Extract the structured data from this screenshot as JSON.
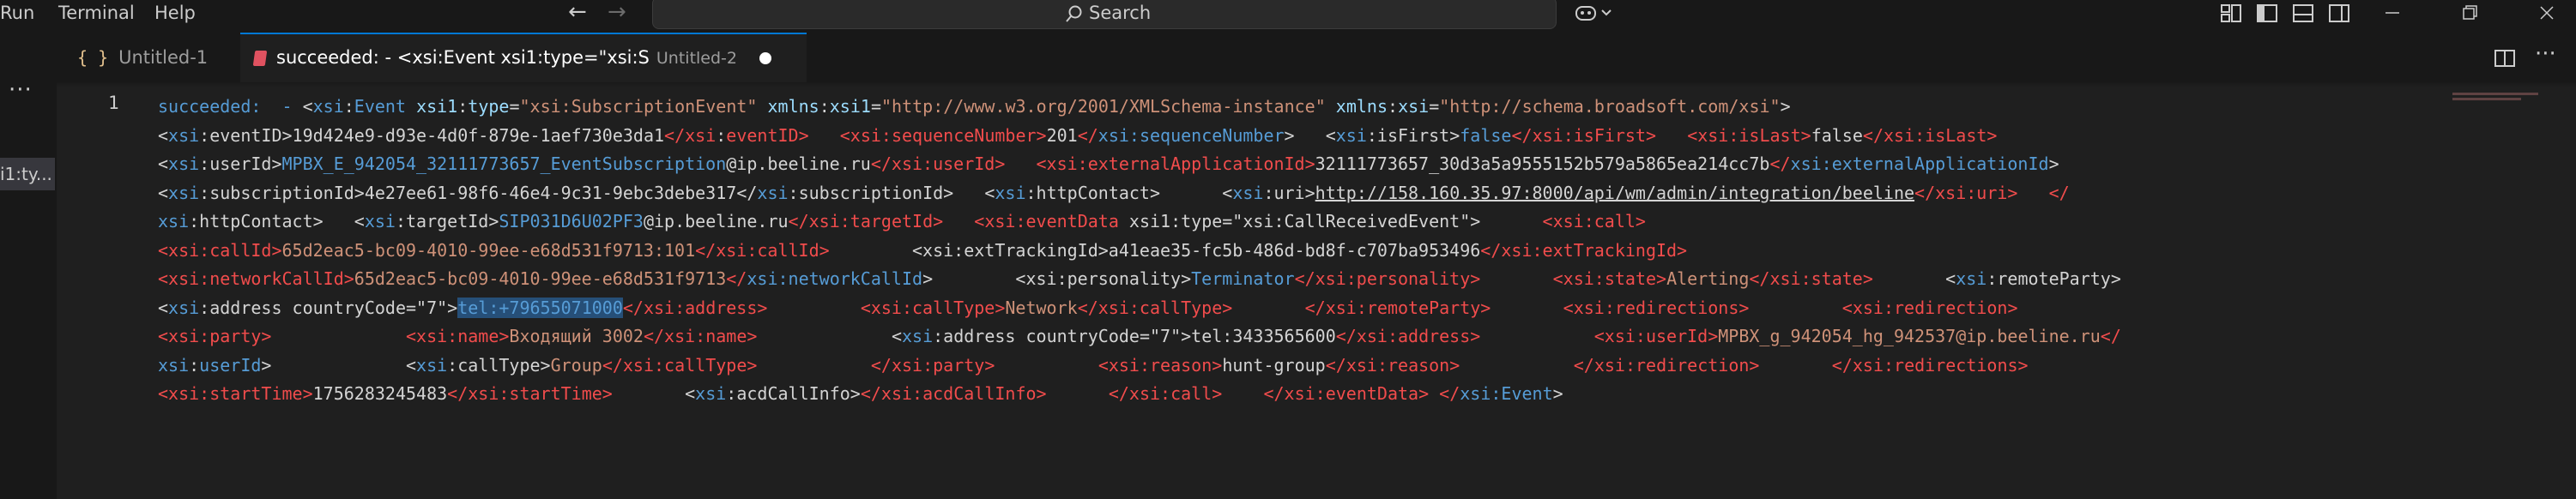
{
  "menu": {
    "items": [
      "Run",
      "Terminal",
      "Help"
    ]
  },
  "search": {
    "label": "Search"
  },
  "activity": {
    "more": "···",
    "peek": "i1:ty..."
  },
  "tabs": [
    {
      "icon": "{ }",
      "label": "Untitled-1"
    },
    {
      "label": "succeeded: - <xsi:Event xsi1:type=\"xsi:S",
      "desc": "Untitled-2"
    }
  ],
  "editor": {
    "line_number": "1",
    "rows": [
      [
        {
          "c": "t-bl",
          "t": "succeeded:  - "
        },
        {
          "c": "t-plain",
          "t": "<"
        },
        {
          "c": "t-ns",
          "t": "xsi"
        },
        {
          "c": "t-plain",
          "t": ":"
        },
        {
          "c": "t-ns",
          "t": "Event"
        },
        {
          "c": "t-plain",
          "t": " "
        },
        {
          "c": "t-attr",
          "t": "xsi1"
        },
        {
          "c": "t-plain",
          "t": ":"
        },
        {
          "c": "t-attr",
          "t": "type"
        },
        {
          "c": "t-plain",
          "t": "="
        },
        {
          "c": "t-str",
          "t": "\"xsi:SubscriptionEvent\""
        },
        {
          "c": "t-plain",
          "t": " "
        },
        {
          "c": "t-attr",
          "t": "xmlns"
        },
        {
          "c": "t-plain",
          "t": ":"
        },
        {
          "c": "t-attr",
          "t": "xsi1"
        },
        {
          "c": "t-plain",
          "t": "="
        },
        {
          "c": "t-str",
          "t": "\"http://www.w3.org/2001/XMLSchema-instance\""
        },
        {
          "c": "t-plain",
          "t": " "
        },
        {
          "c": "t-attr",
          "t": "xmlns"
        },
        {
          "c": "t-plain",
          "t": ":"
        },
        {
          "c": "t-attr",
          "t": "xsi"
        },
        {
          "c": "t-plain",
          "t": "="
        },
        {
          "c": "t-str",
          "t": "\"http://schema.broadsoft.com/xsi\""
        },
        {
          "c": "t-plain",
          "t": ">"
        }
      ],
      [
        {
          "c": "t-plain",
          "t": "<"
        },
        {
          "c": "t-ns",
          "t": "xsi"
        },
        {
          "c": "t-plain",
          "t": ":eventID>"
        },
        {
          "c": "t-plain",
          "t": "19d424e9-d93e-4d0f-879e-1aef730e3da1"
        },
        {
          "c": "t-tag",
          "t": "</"
        },
        {
          "c": "t-tag",
          "t": "xsi"
        },
        {
          "c": "t-plain",
          "t": ":"
        },
        {
          "c": "t-tag",
          "t": "eventID>"
        },
        {
          "c": "t-plain",
          "t": "   "
        },
        {
          "c": "t-tag",
          "t": "<xsi:sequenceNumber>"
        },
        {
          "c": "t-plain",
          "t": "201"
        },
        {
          "c": "t-tag",
          "t": "</"
        },
        {
          "c": "t-ns",
          "t": "xsi:sequenceNumber"
        },
        {
          "c": "t-plain",
          "t": ">   "
        },
        {
          "c": "t-plain",
          "t": "<"
        },
        {
          "c": "t-ns",
          "t": "xsi"
        },
        {
          "c": "t-plain",
          "t": ":isFirst>"
        },
        {
          "c": "t-bl",
          "t": "false"
        },
        {
          "c": "t-tag",
          "t": "</xsi:isFirst>"
        },
        {
          "c": "t-plain",
          "t": "   "
        },
        {
          "c": "t-tag",
          "t": "<xsi:isLast>"
        },
        {
          "c": "t-plain",
          "t": "false"
        },
        {
          "c": "t-tag",
          "t": "</xsi:isLast>"
        }
      ],
      [
        {
          "c": "t-plain",
          "t": "<"
        },
        {
          "c": "t-ns",
          "t": "xsi"
        },
        {
          "c": "t-plain",
          "t": ":userId>"
        },
        {
          "c": "t-bl",
          "t": "MPBX_E_942054_32111773657_EventSubscription"
        },
        {
          "c": "t-plain",
          "t": "@ip.beeline.ru"
        },
        {
          "c": "t-tag",
          "t": "</xsi:userId>"
        },
        {
          "c": "t-plain",
          "t": "   "
        },
        {
          "c": "t-tag",
          "t": "<xsi:externalApplicationId>"
        },
        {
          "c": "t-plain",
          "t": "32111773657_30d3a5a9555152b579a5865ea214cc7b"
        },
        {
          "c": "t-tag",
          "t": "</"
        },
        {
          "c": "t-ns",
          "t": "xsi:externalApplicationId"
        },
        {
          "c": "t-plain",
          "t": ">"
        }
      ],
      [
        {
          "c": "t-plain",
          "t": "<"
        },
        {
          "c": "t-ns",
          "t": "xsi"
        },
        {
          "c": "t-plain",
          "t": ":subscriptionId>"
        },
        {
          "c": "t-plain",
          "t": "4e27ee61-98f6-46e4-9c31-9ebc3debe317"
        },
        {
          "c": "t-plain",
          "t": "</"
        },
        {
          "c": "t-ns",
          "t": "xsi"
        },
        {
          "c": "t-plain",
          "t": ":subscriptionId>   "
        },
        {
          "c": "t-plain",
          "t": "<"
        },
        {
          "c": "t-ns",
          "t": "xsi"
        },
        {
          "c": "t-plain",
          "t": ":httpContact>      "
        },
        {
          "c": "t-plain",
          "t": "<"
        },
        {
          "c": "t-ns",
          "t": "xsi"
        },
        {
          "c": "t-plain",
          "t": ":uri>"
        },
        {
          "c": "t-link",
          "t": "http://158.160.35.97:8000/api/wm/admin/integration/beeline"
        },
        {
          "c": "t-tag",
          "t": "</xsi:uri>"
        },
        {
          "c": "t-plain",
          "t": "   "
        },
        {
          "c": "t-tag",
          "t": "</"
        }
      ],
      [
        {
          "c": "t-ns",
          "t": "xsi"
        },
        {
          "c": "t-plain",
          "t": ":httpContact>   "
        },
        {
          "c": "t-plain",
          "t": "<"
        },
        {
          "c": "t-ns",
          "t": "xsi"
        },
        {
          "c": "t-plain",
          "t": ":targetId>"
        },
        {
          "c": "t-bl",
          "t": "SIP031D6U02PF3"
        },
        {
          "c": "t-plain",
          "t": "@ip.beeline.ru"
        },
        {
          "c": "t-tag",
          "t": "</xsi:targetId>"
        },
        {
          "c": "t-plain",
          "t": "   "
        },
        {
          "c": "t-tag",
          "t": "<xsi:eventData"
        },
        {
          "c": "t-plain",
          "t": " xsi1:type=\"xsi:CallReceivedEvent\">      "
        },
        {
          "c": "t-tag",
          "t": "<xsi:call>"
        }
      ],
      [
        {
          "c": "t-tag",
          "t": "<xsi:callId>"
        },
        {
          "c": "t-str",
          "t": "65d2eac5-bc09-4010-99ee-e68d531f9713:101"
        },
        {
          "c": "t-tag",
          "t": "</xsi:callId>"
        },
        {
          "c": "t-plain",
          "t": "        "
        },
        {
          "c": "t-plain",
          "t": "<xsi:extTrackingId>a41eae35-fc5b-486d-bd8f-c707ba953496"
        },
        {
          "c": "t-tag",
          "t": "</xsi:extTrackingId>"
        }
      ],
      [
        {
          "c": "t-tag",
          "t": "<xsi:networkCallId>"
        },
        {
          "c": "t-str",
          "t": "65d2eac5-bc09-4010-99ee-e68d531f9713"
        },
        {
          "c": "t-tag",
          "t": "</"
        },
        {
          "c": "t-ns",
          "t": "xsi:networkCallId"
        },
        {
          "c": "t-plain",
          "t": ">        <xsi:personality>"
        },
        {
          "c": "t-bl",
          "t": "Terminator"
        },
        {
          "c": "t-tag",
          "t": "</xsi:personality>"
        },
        {
          "c": "t-plain",
          "t": "       "
        },
        {
          "c": "t-tag",
          "t": "<xsi:state>"
        },
        {
          "c": "t-str",
          "t": "Alerting"
        },
        {
          "c": "t-tag",
          "t": "</xsi:state>"
        },
        {
          "c": "t-plain",
          "t": "       <"
        },
        {
          "c": "t-ns",
          "t": "xsi"
        },
        {
          "c": "t-plain",
          "t": ":remoteParty>"
        }
      ],
      [
        {
          "c": "t-plain",
          "t": "<"
        },
        {
          "c": "t-ns",
          "t": "xsi"
        },
        {
          "c": "t-plain",
          "t": ":address countryCode=\"7\">"
        },
        {
          "c": "t-sel t-bl",
          "t": "tel:+79655071000"
        },
        {
          "c": "t-tag",
          "t": "</xsi:address>"
        },
        {
          "c": "t-plain",
          "t": "         "
        },
        {
          "c": "t-tag",
          "t": "<xsi:callType>"
        },
        {
          "c": "t-str",
          "t": "Network"
        },
        {
          "c": "t-tag",
          "t": "</xsi:callType>"
        },
        {
          "c": "t-plain",
          "t": "       "
        },
        {
          "c": "t-tag",
          "t": "</xsi:remoteParty>"
        },
        {
          "c": "t-plain",
          "t": "       "
        },
        {
          "c": "t-tag",
          "t": "<xsi:redirections>"
        },
        {
          "c": "t-plain",
          "t": "         "
        },
        {
          "c": "t-tag",
          "t": "<xsi:redirection>"
        }
      ],
      [
        {
          "c": "t-tag",
          "t": "<xsi:party>"
        },
        {
          "c": "t-plain",
          "t": "             "
        },
        {
          "c": "t-tag",
          "t": "<xsi:name>"
        },
        {
          "c": "t-str",
          "t": "Входящий 3002"
        },
        {
          "c": "t-tag",
          "t": "</xsi:name>"
        },
        {
          "c": "t-plain",
          "t": "             <"
        },
        {
          "c": "t-ns",
          "t": "xsi"
        },
        {
          "c": "t-plain",
          "t": ":address countryCode=\"7\">"
        },
        {
          "c": "t-plain",
          "t": "tel:3433565600"
        },
        {
          "c": "t-tag",
          "t": "</xsi:address>"
        },
        {
          "c": "t-plain",
          "t": "           "
        },
        {
          "c": "t-tag",
          "t": "<xsi:userId>"
        },
        {
          "c": "t-str",
          "t": "MPBX_g_942054_hg_942537@ip.beeline.ru"
        },
        {
          "c": "t-tag",
          "t": "</"
        }
      ],
      [
        {
          "c": "t-ns",
          "t": "xsi"
        },
        {
          "c": "t-plain",
          "t": ":"
        },
        {
          "c": "t-ns",
          "t": "userId"
        },
        {
          "c": "t-plain",
          "t": ">             <"
        },
        {
          "c": "t-ns",
          "t": "xsi"
        },
        {
          "c": "t-plain",
          "t": ":callType>"
        },
        {
          "c": "t-str",
          "t": "Group"
        },
        {
          "c": "t-tag",
          "t": "</xsi:callType>"
        },
        {
          "c": "t-plain",
          "t": "           "
        },
        {
          "c": "t-tag",
          "t": "</xsi:party>"
        },
        {
          "c": "t-plain",
          "t": "          "
        },
        {
          "c": "t-tag",
          "t": "<xsi:reason>"
        },
        {
          "c": "t-plain",
          "t": "hunt-group"
        },
        {
          "c": "t-tag",
          "t": "</xsi:reason>"
        },
        {
          "c": "t-plain",
          "t": "           "
        },
        {
          "c": "t-tag",
          "t": "</xsi:redirection>"
        },
        {
          "c": "t-plain",
          "t": "       "
        },
        {
          "c": "t-tag",
          "t": "</xsi:redirections>"
        }
      ],
      [
        {
          "c": "t-tag",
          "t": "<xsi:startTime>"
        },
        {
          "c": "t-plain",
          "t": "1756283245483"
        },
        {
          "c": "t-tag",
          "t": "</xsi:startTime>"
        },
        {
          "c": "t-plain",
          "t": "       <"
        },
        {
          "c": "t-ns",
          "t": "xsi"
        },
        {
          "c": "t-plain",
          "t": ":acdCallInfo>"
        },
        {
          "c": "t-tag",
          "t": "</xsi:acdCallInfo>"
        },
        {
          "c": "t-plain",
          "t": "      "
        },
        {
          "c": "t-tag",
          "t": "</xsi:call>"
        },
        {
          "c": "t-plain",
          "t": "    "
        },
        {
          "c": "t-tag",
          "t": "</xsi:eventData>"
        },
        {
          "c": "t-plain",
          "t": " "
        },
        {
          "c": "t-tag",
          "t": "</"
        },
        {
          "c": "t-ns",
          "t": "xsi:Event"
        },
        {
          "c": "t-plain",
          "t": ">"
        }
      ]
    ]
  },
  "colors": {
    "accent": "#0078d4",
    "tag": "#f14c4c",
    "namespace": "#569cd6",
    "string": "#ce9178",
    "attr": "#9cdcfe"
  }
}
